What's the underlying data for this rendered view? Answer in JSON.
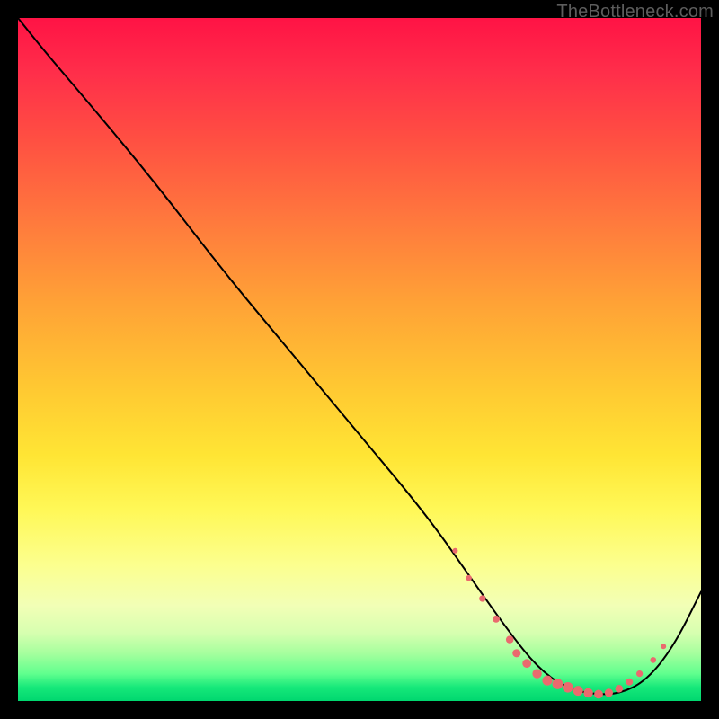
{
  "watermark": "TheBottleneck.com",
  "chart_data": {
    "type": "line",
    "title": "",
    "xlabel": "",
    "ylabel": "",
    "xlim": [
      0,
      100
    ],
    "ylim": [
      0,
      100
    ],
    "background_gradient": {
      "orientation": "vertical",
      "stops": [
        {
          "at": 0,
          "color": "#ff1345"
        },
        {
          "at": 30,
          "color": "#ff7a3d"
        },
        {
          "at": 55,
          "color": "#ffc832"
        },
        {
          "at": 75,
          "color": "#fff857"
        },
        {
          "at": 90,
          "color": "#d7ffb0"
        },
        {
          "at": 100,
          "color": "#00d76f"
        }
      ]
    },
    "series": [
      {
        "name": "curve",
        "color": "#000000",
        "stroke_width": 2,
        "x": [
          0,
          4,
          10,
          20,
          30,
          40,
          50,
          60,
          67,
          72,
          76,
          80,
          84,
          88,
          92,
          96,
          100
        ],
        "y": [
          100,
          95,
          88,
          76,
          63,
          51,
          39,
          27,
          17,
          10,
          5,
          2,
          1,
          1,
          3,
          8,
          16
        ]
      }
    ],
    "markers": {
      "name": "dotted-trough",
      "color": "#ea6a6e",
      "radius_min": 3,
      "radius_max": 6,
      "points": [
        {
          "x": 64,
          "y": 22
        },
        {
          "x": 66,
          "y": 18
        },
        {
          "x": 68,
          "y": 15
        },
        {
          "x": 70,
          "y": 12
        },
        {
          "x": 72,
          "y": 9
        },
        {
          "x": 73,
          "y": 7
        },
        {
          "x": 74.5,
          "y": 5.5
        },
        {
          "x": 76,
          "y": 4
        },
        {
          "x": 77.5,
          "y": 3
        },
        {
          "x": 79,
          "y": 2.5
        },
        {
          "x": 80.5,
          "y": 2
        },
        {
          "x": 82,
          "y": 1.5
        },
        {
          "x": 83.5,
          "y": 1.2
        },
        {
          "x": 85,
          "y": 1
        },
        {
          "x": 86.5,
          "y": 1.2
        },
        {
          "x": 88,
          "y": 1.8
        },
        {
          "x": 89.5,
          "y": 2.8
        },
        {
          "x": 91,
          "y": 4
        },
        {
          "x": 93,
          "y": 6
        },
        {
          "x": 94.5,
          "y": 8
        }
      ]
    }
  }
}
